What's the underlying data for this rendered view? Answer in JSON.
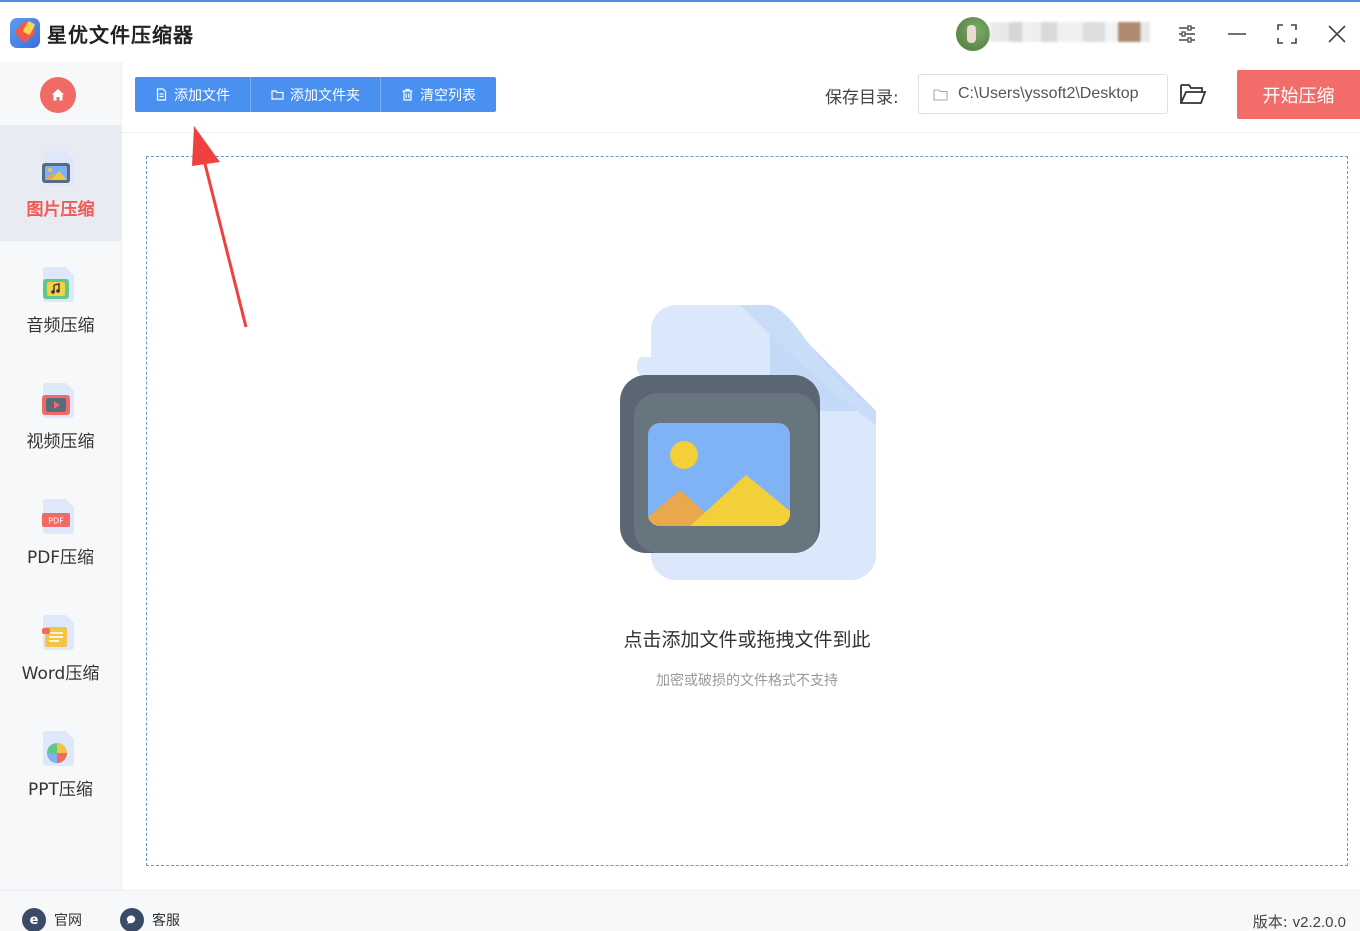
{
  "app": {
    "title": "星优文件压缩器"
  },
  "sidebar": {
    "items": [
      {
        "label": "图片压缩",
        "icon": "image-file-icon",
        "active": true
      },
      {
        "label": "音频压缩",
        "icon": "audio-file-icon",
        "active": false
      },
      {
        "label": "视频压缩",
        "icon": "video-file-icon",
        "active": false
      },
      {
        "label": "PDF压缩",
        "icon": "pdf-file-icon",
        "active": false
      },
      {
        "label": "Word压缩",
        "icon": "word-file-icon",
        "active": false
      },
      {
        "label": "PPT压缩",
        "icon": "ppt-file-icon",
        "active": false
      }
    ]
  },
  "toolbar": {
    "add_file": "添加文件",
    "add_folder": "添加文件夹",
    "clear_list": "清空列表",
    "save_label": "保存目录:",
    "save_path": "C:\\Users\\yssoft2\\Desktop",
    "start": "开始压缩"
  },
  "dropzone": {
    "title": "点击添加文件或拖拽文件到此",
    "subtitle": "加密或破损的文件格式不支持"
  },
  "footer": {
    "site": "官网",
    "service": "客服",
    "version_label": "版本:",
    "version": "v2.2.0.0"
  },
  "colors": {
    "accent_blue": "#4a90f0",
    "accent_red": "#f26d6a",
    "active_nav_text": "#f05a55"
  }
}
